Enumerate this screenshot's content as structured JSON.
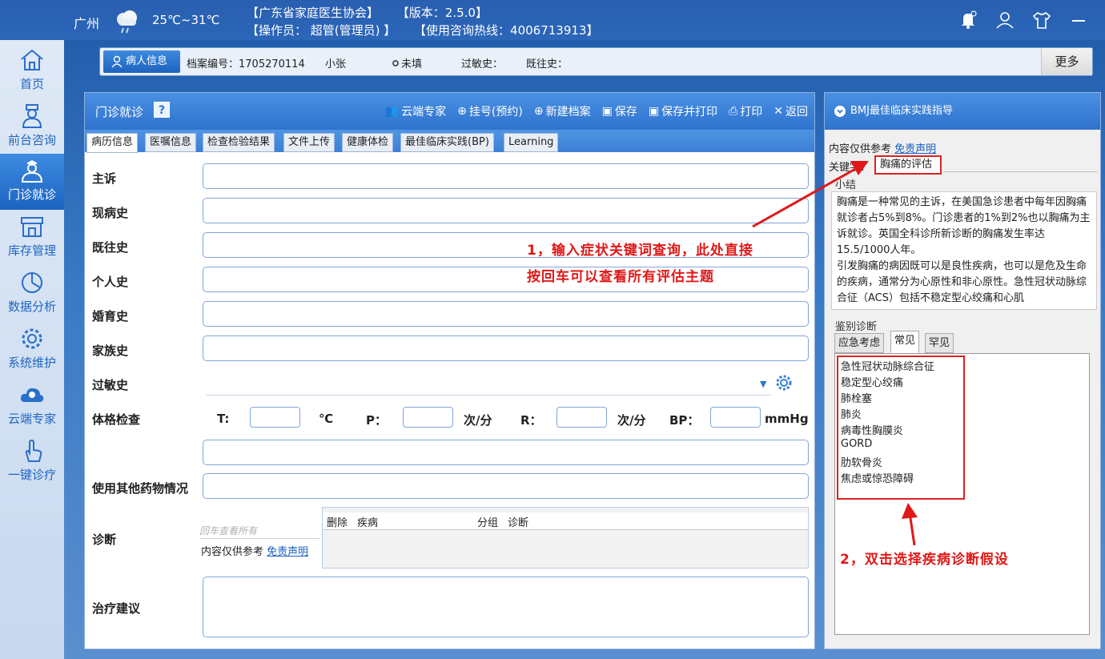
{
  "topbar": {
    "city": "广州",
    "temperature": "25℃~31℃",
    "org": "【广东省家庭医生协会】",
    "version": "【版本：2.5.0】",
    "operator": "【操作员： 超管(管理员) 】",
    "hotline": "【使用咨询热线：4006713913】"
  },
  "sidebar": {
    "items": [
      {
        "label": "首页",
        "icon": "home-icon"
      },
      {
        "label": "前台咨询",
        "icon": "receptionist-icon"
      },
      {
        "label": "门诊就诊",
        "icon": "doctor-icon"
      },
      {
        "label": "库存管理",
        "icon": "store-icon"
      },
      {
        "label": "数据分析",
        "icon": "chart-icon"
      },
      {
        "label": "系统维护",
        "icon": "gear-icon"
      },
      {
        "label": "云端专家",
        "icon": "cloud-expert-icon"
      },
      {
        "label": "一键诊疗",
        "icon": "touch-icon"
      }
    ]
  },
  "patient": {
    "tag_label": "病人信息",
    "record_no": "档案编号：1705270114",
    "name": "小张",
    "status": "未填",
    "allergy": "过敏史：",
    "history": "既往史：",
    "more_label": "更多"
  },
  "main": {
    "title": "门诊就诊",
    "help": "?",
    "actions": [
      "云端专家",
      "挂号(预约)",
      "新建档案",
      "保存",
      "保存并打印",
      "打印",
      "返回"
    ],
    "tabs": [
      "病历信息",
      "医嘱信息",
      "检查检验结果",
      "文件上传",
      "健康体检",
      "最佳临床实践(BP)",
      "Learning"
    ],
    "fields": {
      "complaint": "主诉",
      "present": "现病史",
      "past": "既往史",
      "personal": "个人史",
      "marital": "婚育史",
      "family": "家族史",
      "allergy": "过敏史",
      "exam": "体格检查",
      "other_drugs": "使用其他药物情况",
      "diagnosis": "诊断",
      "treatment": "治疗建议"
    },
    "vitals": {
      "t_label": "T:",
      "t_unit": "℃",
      "p_label": "P：",
      "p_unit": "次/分",
      "r_label": "R：",
      "r_unit": "次/分",
      "bp_label": "BP：",
      "bp_unit": "mmHg"
    },
    "diag_placeholder": "回车查看所有",
    "diag_note": "内容仅供参考 ",
    "diag_disclaimer": "免责声明",
    "diag_table_headers": [
      "删除",
      "疾病",
      "分组",
      "诊断"
    ]
  },
  "right": {
    "title": "BMJ最佳临床实践指导",
    "ref_note": "内容仅供参考 ",
    "disclaimer": "免责声明",
    "keyword_label": "关键字：",
    "keyword_value": "胸痛的评估",
    "summary_label": "小结",
    "summary_p1": "胸痛是一种常见的主诉，在美国急诊患者中每年因胸痛就诊者占5%到8%。门诊患者的1%到2%也以胸痛为主诉就诊。英国全科诊所新诊断的胸痛发生率达15.5/1000人年。",
    "summary_p2": "引发胸痛的病因既可以是良性疾病，也可以是危及生命的疾病，通常分为心原性和非心原性。急性冠状动脉综合征（ACS）包括不稳定型心绞痛和心肌",
    "dd_label": "鉴别诊断",
    "dd_tabs": [
      "应急考虑",
      "常见",
      "罕见"
    ],
    "dd_items": [
      "急性冠状动脉综合征",
      "稳定型心绞痛",
      "肺栓塞",
      "肺炎",
      "病毒性胸膜炎",
      "GORD",
      "肋软骨炎",
      "焦虑或惊恐障碍"
    ]
  },
  "annotations": {
    "a1_line1": "1，输入症状关键词查询，此处直接",
    "a1_line2": "按回车可以查看所有评估主题",
    "a2": "2，双击选择疾病诊断假设"
  },
  "colors": {
    "accent": "#2f73ce",
    "annotation_red": "#e01818"
  }
}
